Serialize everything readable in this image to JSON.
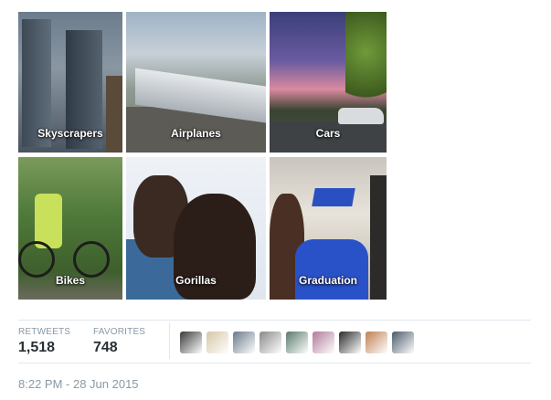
{
  "collections": [
    {
      "label": "Skyscrapers"
    },
    {
      "label": "Airplanes"
    },
    {
      "label": "Cars"
    },
    {
      "label": "Bikes"
    },
    {
      "label": "Gorillas"
    },
    {
      "label": "Graduation"
    }
  ],
  "stats": {
    "retweets_label": "RETWEETS",
    "retweets_value": "1,518",
    "favorites_label": "FAVORITES",
    "favorites_value": "748"
  },
  "avatar_colors": [
    "#3a3a3a",
    "#d6c7a8",
    "#6a7a8a",
    "#8a8a8a",
    "#5a7a6a",
    "#b07a9a",
    "#2a2a2a",
    "#c08050",
    "#4a5a6a"
  ],
  "timestamp": "8:22 PM - 28 Jun 2015"
}
